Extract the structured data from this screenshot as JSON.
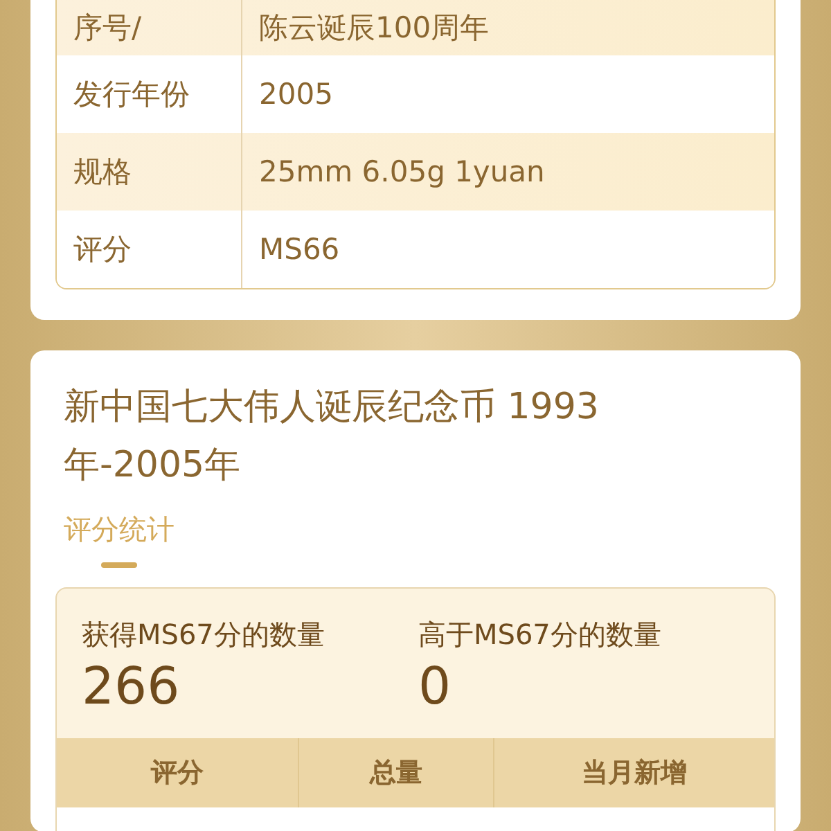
{
  "details": [
    {
      "label": "序号/",
      "value": "陈云诞辰100周年",
      "shaded": true
    },
    {
      "label": "发行年份",
      "value": "2005",
      "shaded": false
    },
    {
      "label": "规格",
      "value": "25mm 6.05g 1yuan",
      "shaded": true
    },
    {
      "label": "评分",
      "value": "MS66",
      "shaded": false
    }
  ],
  "series_title": "新中国七大伟人诞辰纪念币 1993年-2005年",
  "tabs": [
    {
      "label": "评分统计",
      "selected": true
    }
  ],
  "stats": [
    {
      "label": "获得MS67分的数量",
      "value": "266"
    },
    {
      "label": "高于MS67分的数量",
      "value": "0"
    }
  ],
  "table": {
    "columns": [
      "评分",
      "总量",
      "当月新增"
    ]
  }
}
